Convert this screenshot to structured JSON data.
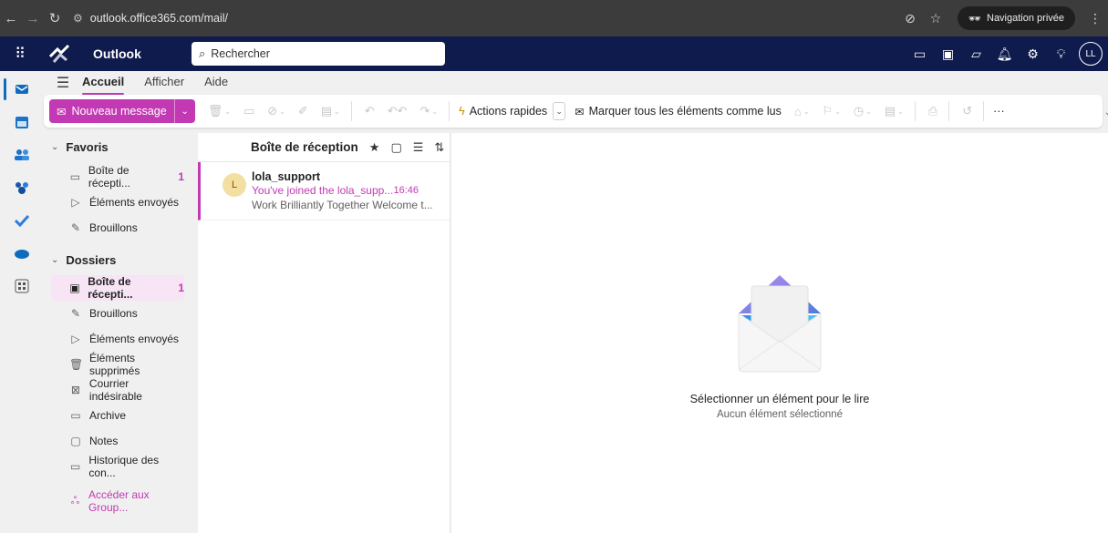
{
  "browser": {
    "url": "outlook.office365.com/mail/",
    "private_label": "Navigation privée"
  },
  "header": {
    "app_title": "Outlook",
    "search_placeholder": "Rechercher",
    "avatar_initials": "LL"
  },
  "tabs": [
    {
      "label": "Accueil",
      "active": true
    },
    {
      "label": "Afficher"
    },
    {
      "label": "Aide"
    }
  ],
  "ribbon": {
    "new_message": "Nouveau message",
    "quick_actions": "Actions rapides",
    "mark_all_read": "Marquer tous les éléments comme lus",
    "more": "···"
  },
  "folders": {
    "favorites_title": "Favoris",
    "favorites": [
      {
        "label": "Boîte de récepti...",
        "count": "1",
        "icon": "inbox-icon"
      },
      {
        "label": "Éléments envoyés",
        "icon": "send-icon"
      },
      {
        "label": "Brouillons",
        "icon": "draft-icon"
      }
    ],
    "folders_title": "Dossiers",
    "items": [
      {
        "label": "Boîte de récepti...",
        "count": "1",
        "icon": "inbox-icon",
        "selected": true
      },
      {
        "label": "Brouillons",
        "icon": "draft-icon"
      },
      {
        "label": "Éléments envoyés",
        "icon": "send-icon"
      },
      {
        "label": "Éléments supprimés",
        "icon": "trash-icon"
      },
      {
        "label": "Courrier indésirable",
        "icon": "junk-icon"
      },
      {
        "label": "Archive",
        "icon": "archive-icon"
      },
      {
        "label": "Notes",
        "icon": "notes-icon"
      },
      {
        "label": "Historique des con...",
        "icon": "folder-icon"
      }
    ],
    "groups_link": "Accéder aux Group..."
  },
  "message_list": {
    "title": "Boîte de réception",
    "messages": [
      {
        "avatar": "L",
        "from": "lola_support",
        "subject": "You've joined the lola_supp...",
        "time": "16:46",
        "preview": "Work Brilliantly Together Welcome t..."
      }
    ]
  },
  "reading_pane": {
    "title": "Sélectionner un élément pour le lire",
    "subtitle": "Aucun élément sélectionné"
  },
  "colors": {
    "accent": "#c239b3",
    "header_bg": "#0f1b4d",
    "browser_bg": "#3c3c3c"
  }
}
